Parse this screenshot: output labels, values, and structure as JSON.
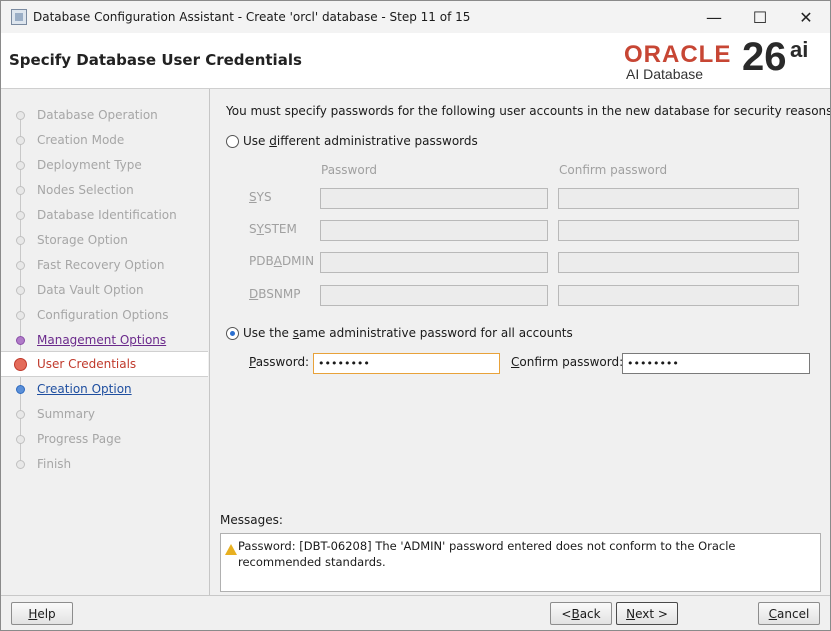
{
  "window": {
    "title": "Database Configuration Assistant - Create 'orcl' database - Step 11 of 15"
  },
  "header": {
    "page_title": "Specify Database User Credentials",
    "logo_oracle": "ORACLE",
    "logo_subtitle": "AI Database",
    "logo_version": "26",
    "logo_version_suffix": "ai",
    "brand_color": "#c74634"
  },
  "sidebar": {
    "steps": [
      {
        "label": "Database Operation",
        "state": "disabled"
      },
      {
        "label": "Creation Mode",
        "state": "disabled"
      },
      {
        "label": "Deployment Type",
        "state": "disabled"
      },
      {
        "label": "Nodes Selection",
        "state": "disabled"
      },
      {
        "label": "Database Identification",
        "state": "disabled"
      },
      {
        "label": "Storage Option",
        "state": "disabled"
      },
      {
        "label": "Fast Recovery Option",
        "state": "disabled"
      },
      {
        "label": "Data Vault Option",
        "state": "disabled"
      },
      {
        "label": "Configuration Options",
        "state": "disabled"
      },
      {
        "label": "Management Options",
        "state": "visited"
      },
      {
        "label": "User Credentials",
        "state": "current"
      },
      {
        "label": "Creation Option",
        "state": "next"
      },
      {
        "label": "Summary",
        "state": "disabled"
      },
      {
        "label": "Progress Page",
        "state": "disabled"
      },
      {
        "label": "Finish",
        "state": "disabled"
      }
    ]
  },
  "main": {
    "intro": "You must specify passwords for the following user accounts in the new database for security reasons.",
    "option_different": {
      "pre": "Use ",
      "key": "d",
      "post": "ifferent administrative passwords",
      "selected": false
    },
    "col_password": "Password",
    "col_confirm": "Confirm password",
    "accounts": [
      {
        "pre": "",
        "key": "S",
        "post": "YS"
      },
      {
        "pre": "S",
        "key": "Y",
        "post": "STEM"
      },
      {
        "pre": "PDB",
        "key": "A",
        "post": "DMIN"
      },
      {
        "pre": "",
        "key": "D",
        "post": "BSNMP"
      }
    ],
    "option_same": {
      "pre": "Use the ",
      "key": "s",
      "post": "ame administrative password for all accounts",
      "selected": true
    },
    "password_label": {
      "pre": "",
      "key": "P",
      "post": "assword:"
    },
    "password_value": "••••••••",
    "confirm_label": {
      "pre": "",
      "key": "C",
      "post": "onfirm password:"
    },
    "confirm_value": "••••••••"
  },
  "messages": {
    "label": "Messages:",
    "text": "Password: [DBT-06208] The 'ADMIN' password entered does not conform to the Oracle recommended standards.",
    "icon": "warning-icon"
  },
  "footer": {
    "help": {
      "pre": "",
      "key": "H",
      "post": "elp"
    },
    "back": {
      "pre": "< ",
      "key": "B",
      "post": "ack"
    },
    "next": {
      "pre": "",
      "key": "N",
      "post": "ext >"
    },
    "cancel": {
      "pre": "",
      "key": "C",
      "post": "ancel"
    }
  }
}
